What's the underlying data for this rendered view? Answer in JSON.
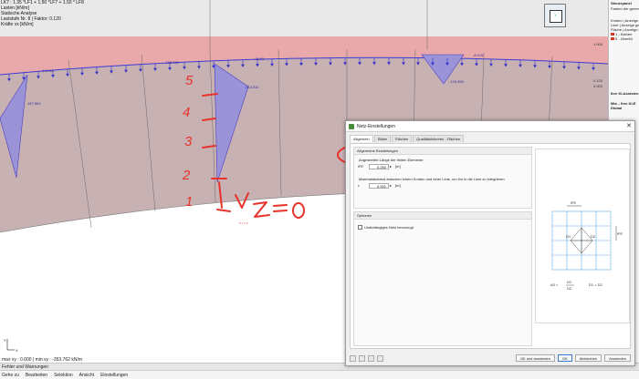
{
  "info": {
    "lines": [
      "LK7 : 1.35 *LF1 + 1.50 *LF7 + 1.50 * LF8",
      "Lasten [kN/m]",
      "Statische Analyse",
      "Laststufe Nr. 8 | Faktor: 0.120",
      "Kräfte vx [kN/m]"
    ]
  },
  "diagram": {
    "value_labels": [
      "-6.6 kN",
      "157.963",
      "-313.511",
      "-28.31",
      "-176.950",
      "-8.976",
      "-135.761"
    ],
    "scale_labels": [
      "1.000",
      "0.120",
      "0.000"
    ]
  },
  "max_text": "max vy : 0.000 | min vy : -353.762 kN/m",
  "warnings_label": "Fehler und Warnungen",
  "menu": [
    "Gehe zu",
    "Bearbeiten",
    "Selektion",
    "Ansicht",
    "Einstellungen"
  ],
  "right_panel": {
    "title": "Steuerpanel",
    "lines": [
      "Farben der generi",
      "Knoten | Anzeige",
      "Linie | Anzeige ge",
      "Fläche | Anzeige g"
    ],
    "legend": [
      {
        "label": "1 - Kleberr",
        "color": "#d9342b"
      },
      {
        "label": "5 - Überfül",
        "color": "#d9342b"
      }
    ],
    "assistant_title": "Ihre KI-Assisten",
    "assistant_sub": "Mia – Ihre KI-E",
    "assistant_sub2": "Dlubal"
  },
  "dialog": {
    "title": "Netz-Einstellungen",
    "tabs": [
      "Allgemein",
      "Stäbe",
      "Flächen",
      "Qualitätskriterien - Flächen"
    ],
    "active_tab": "Allgemein",
    "general_group_title": "Allgemeine Einstellungen",
    "target_length_label": "Angestrebte Länge der finiten Elemente",
    "target_length_symbol": "lFE",
    "target_length_value": "0.250",
    "target_length_unit": "[m]",
    "max_distance_label": "Maximalabstand zwischen einem Knoten und einer Linie, um ihn in die Linie zu integrieren",
    "max_distance_symbol": "ε",
    "max_distance_value": "0.001",
    "max_distance_unit": "[m]",
    "options_group_title": "Optionen",
    "checkbox_label": "Unabhängiges Netz bevorzugt",
    "checkbox_checked": false,
    "preview": {
      "top_dim": "lFE",
      "side_dim": "lFE",
      "d1": "D1",
      "d2": "D2",
      "formula_left": "Δ0 =",
      "formula_mid_num": "D1",
      "formula_mid_den": "D2",
      "formula_right": "D1 > D2"
    },
    "buttons": {
      "ok_apply": "OK und anwenden",
      "ok": "OK",
      "cancel": "Abbrechen",
      "apply": "Anwenden"
    }
  },
  "annotations": {
    "numbers": [
      "5",
      "4",
      "3",
      "2",
      "1"
    ],
    "equation": "V z = 0"
  }
}
